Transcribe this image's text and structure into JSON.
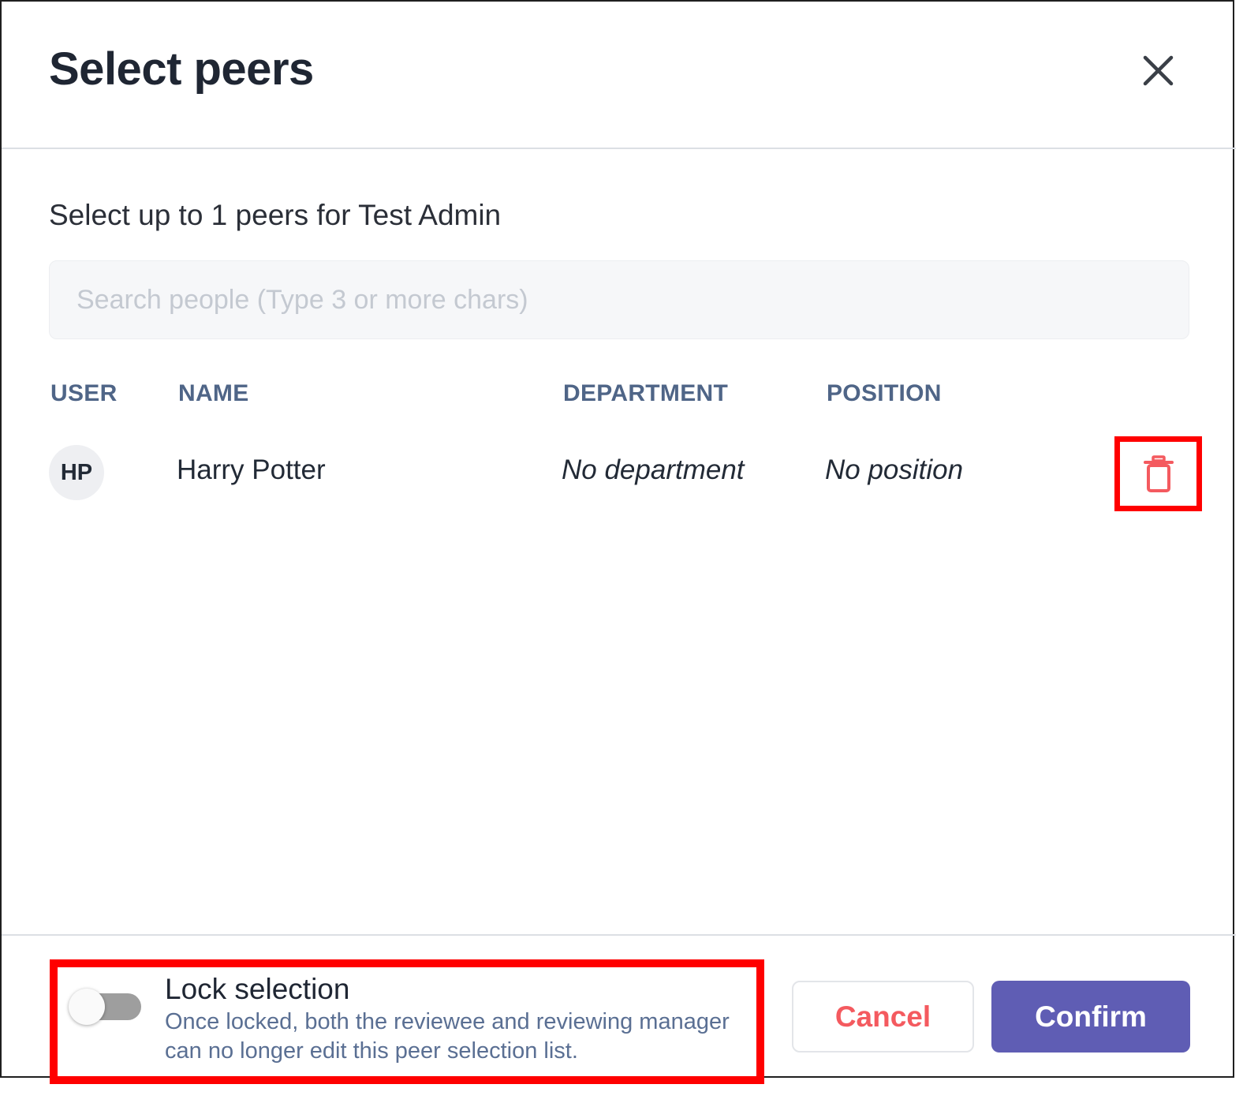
{
  "dialog": {
    "title": "Select peers",
    "subtitle": "Select up to 1 peers for Test Admin"
  },
  "search": {
    "placeholder": "Search people (Type 3 or more chars)",
    "value": ""
  },
  "table": {
    "columns": [
      "USER",
      "NAME",
      "DEPARTMENT",
      "POSITION"
    ],
    "rows": [
      {
        "initials": "HP",
        "name": "Harry Potter",
        "department": "No department",
        "position": "No position"
      }
    ]
  },
  "lock": {
    "title": "Lock selection",
    "description": "Once locked, both the reviewee and reviewing manager can no longer edit this peer selection list.",
    "enabled": false
  },
  "footer": {
    "cancel_label": "Cancel",
    "confirm_label": "Confirm"
  },
  "icons": {
    "close": "close-icon",
    "delete": "trash-icon"
  },
  "colors": {
    "accent": "#5f5db4",
    "danger": "#f45a5f",
    "highlight": "#ff0000",
    "header_text": "#4f6587"
  }
}
